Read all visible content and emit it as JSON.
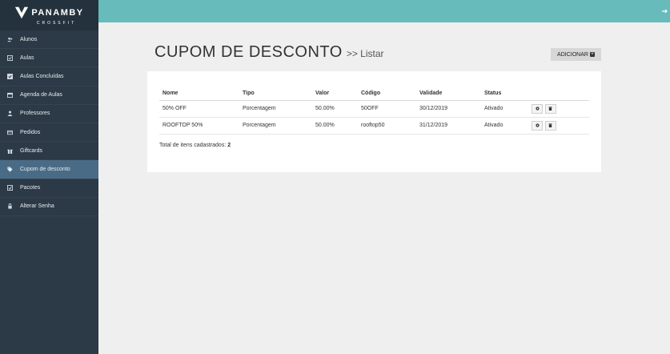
{
  "brand": {
    "name": "PANAMBY",
    "sub": "CROSSFIT"
  },
  "sidebar": {
    "items": [
      {
        "label": "Alunos",
        "icon": "users-icon"
      },
      {
        "label": "Aulas",
        "icon": "check-square-icon"
      },
      {
        "label": "Aulas Concluídas",
        "icon": "checkbox-icon"
      },
      {
        "label": "Agenda de Aulas",
        "icon": "calendar-icon"
      },
      {
        "label": "Professores",
        "icon": "user-icon"
      },
      {
        "label": "Pedidos",
        "icon": "credit-card-icon"
      },
      {
        "label": "Giftcards",
        "icon": "gift-icon"
      },
      {
        "label": "Cupom de desconto",
        "icon": "tag-icon",
        "active": true
      },
      {
        "label": "Pacotes",
        "icon": "package-icon"
      },
      {
        "label": "Alterar Senha",
        "icon": "lock-icon"
      }
    ]
  },
  "page": {
    "title": "CUPOM DE DESCONTO",
    "subtitle": ">> Listar",
    "add_label": "ADICIONAR"
  },
  "table": {
    "headers": [
      "Nome",
      "Tipo",
      "Valor",
      "Código",
      "Validade",
      "Status"
    ],
    "rows": [
      [
        "50% OFF",
        "Porcentagem",
        "50.00%",
        "50OFF",
        "30/12/2019",
        "Ativado"
      ],
      [
        "ROOFTOP 50%",
        "Porcentagem",
        "50.00%",
        "rooftop50",
        "31/12/2019",
        "Ativado"
      ]
    ]
  },
  "total": {
    "label": "Total de itens cadastrados:",
    "count": "2"
  },
  "colors": {
    "sidebar": "#2b3a46",
    "active": "#4a6b86",
    "topbar": "#67bcbb"
  }
}
